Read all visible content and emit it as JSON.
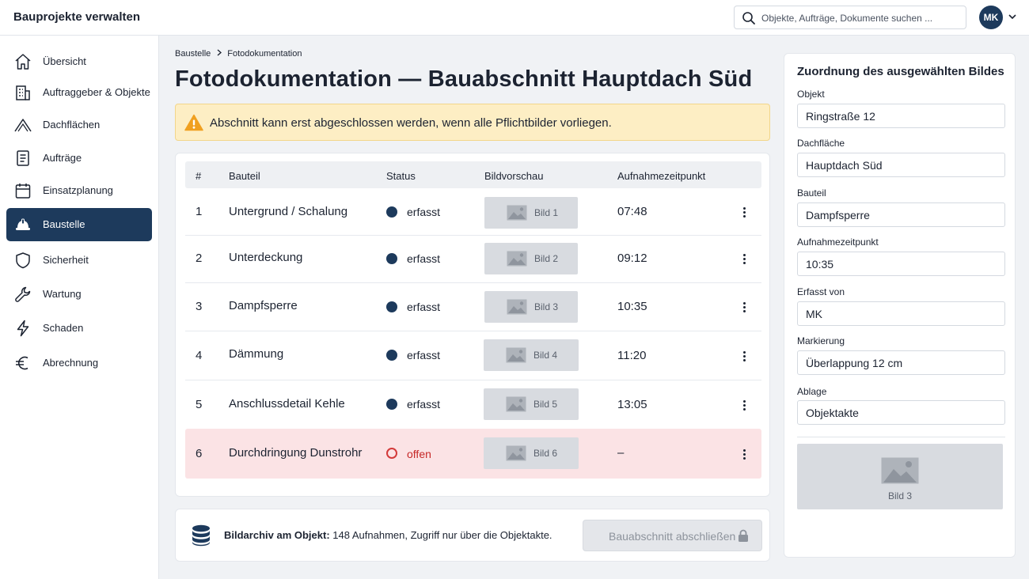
{
  "app": {
    "title": "Bauprojekte verwalten"
  },
  "search": {
    "placeholder": "Objekte, Aufträge, Dokumente suchen ..."
  },
  "user": {
    "initials": "MK"
  },
  "sidebar": {
    "items": [
      {
        "label": "Übersicht",
        "icon": "home-icon"
      },
      {
        "label": "Auftraggeber & Objekte",
        "icon": "building-icon"
      },
      {
        "label": "Dachflächen",
        "icon": "roof-icon"
      },
      {
        "label": "Aufträge",
        "icon": "document-icon"
      },
      {
        "label": "Einsatzplanung",
        "icon": "calendar-icon"
      },
      {
        "label": "Baustelle",
        "icon": "hardhat-icon",
        "active": true
      },
      {
        "label": "Sicherheit",
        "icon": "shield-icon"
      },
      {
        "label": "Wartung",
        "icon": "wrench-icon"
      },
      {
        "label": "Schaden",
        "icon": "lightning-icon"
      },
      {
        "label": "Abrechnung",
        "icon": "euro-icon"
      }
    ]
  },
  "breadcrumb": {
    "parent": "Baustelle",
    "current": "Fotodokumentation"
  },
  "page": {
    "title": "Fotodokumentation — Bauabschnitt Hauptdach Süd"
  },
  "alert": {
    "text": "Abschnitt kann erst abgeschlossen werden, wenn alle Pflichtbilder vorliegen."
  },
  "table": {
    "headers": {
      "num": "#",
      "part": "Bauteil",
      "status": "Status",
      "preview": "Bildvorschau",
      "time": "Aufnahmezeitpunkt"
    },
    "rows": [
      {
        "num": "1",
        "part": "Untergrund / Schalung",
        "status": "erfasst",
        "image": "Bild 1",
        "time": "07:48"
      },
      {
        "num": "2",
        "part": "Unterdeckung",
        "status": "erfasst",
        "image": "Bild 2",
        "time": "09:12"
      },
      {
        "num": "3",
        "part": "Dampfsperre",
        "status": "erfasst",
        "image": "Bild 3",
        "time": "10:35"
      },
      {
        "num": "4",
        "part": "Dämmung",
        "status": "erfasst",
        "image": "Bild 4",
        "time": "11:20"
      },
      {
        "num": "5",
        "part": "Anschlussdetail Kehle",
        "status": "erfasst",
        "image": "Bild 5",
        "time": "13:05"
      },
      {
        "num": "6",
        "part": "Durchdringung Dunstrohr",
        "status": "offen",
        "image": "Bild 6",
        "time": "–"
      }
    ]
  },
  "archive": {
    "label": "Bildarchiv am Objekt:",
    "text": "148 Aufnahmen, Zugriff nur über die Objektakte."
  },
  "actions": {
    "finish_label": "Bauabschnitt abschließen"
  },
  "panel": {
    "title": "Zuordnung des ausgewählten Bildes",
    "fields": {
      "objekt": {
        "label": "Objekt",
        "value": "Ringstraße 12"
      },
      "dachflaeche": {
        "label": "Dachfläche",
        "value": "Hauptdach Süd"
      },
      "bauteil": {
        "label": "Bauteil",
        "value": "Dampfsperre"
      },
      "zeitpunkt": {
        "label": "Aufnahmezeitpunkt",
        "value": "10:35"
      },
      "erfasst": {
        "label": "Erfasst von",
        "value": "MK"
      },
      "markierung": {
        "label": "Markierung",
        "value": "Überlappung 12 cm"
      },
      "ablage": {
        "label": "Ablage",
        "value": "Objektakte"
      }
    },
    "preview_label": "Bild 3"
  },
  "colors": {
    "accent": "#1d3a5c",
    "alert_bg": "#fdeec4",
    "warning": "#f0a020",
    "open_status": "#c62828",
    "open_row_bg": "#fbe3e5"
  }
}
